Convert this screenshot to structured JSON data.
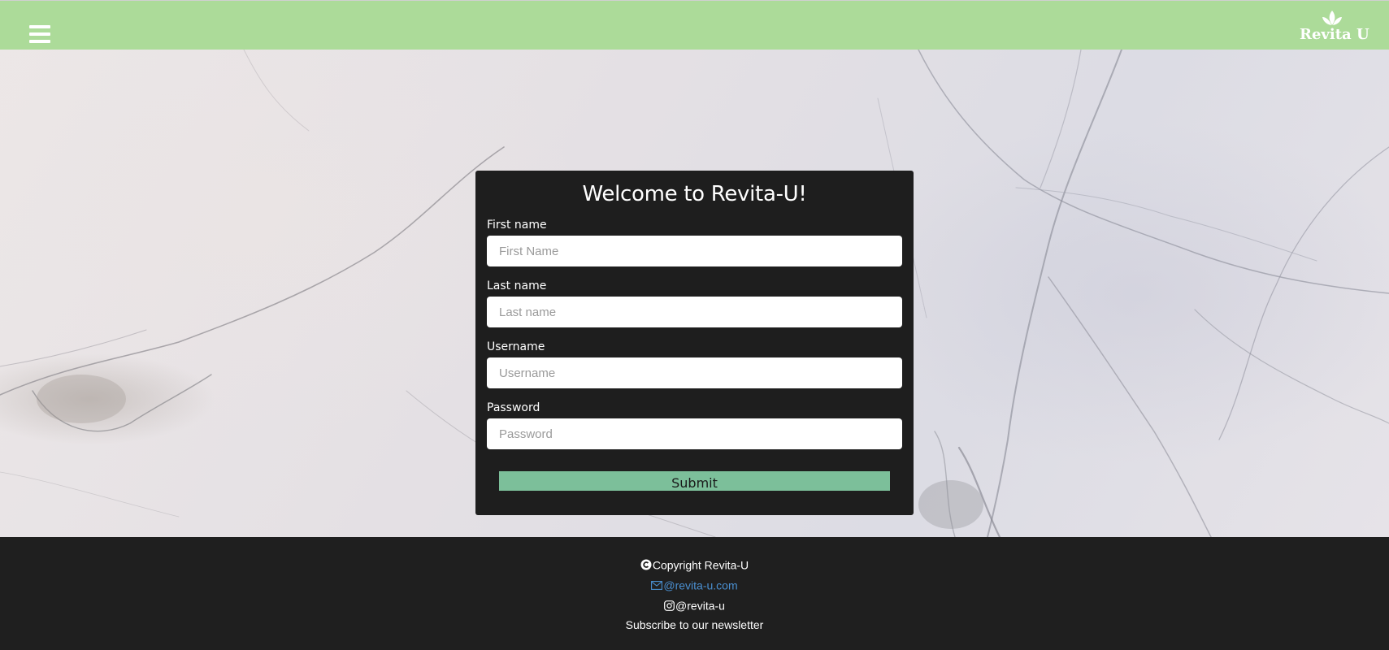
{
  "header": {
    "menu_icon": "hamburger-menu-icon",
    "logo_icon": "leaf-icon",
    "logo_text": "Revita U",
    "background_color": "#acdb99"
  },
  "form": {
    "title": "Welcome to Revita-U!",
    "fields": [
      {
        "label": "First name",
        "placeholder": "First Name",
        "value": ""
      },
      {
        "label": "Last name",
        "placeholder": "Last name",
        "value": ""
      },
      {
        "label": "Username",
        "placeholder": "Username",
        "value": ""
      },
      {
        "label": "Password",
        "placeholder": "Password",
        "value": ""
      }
    ],
    "submit_label": "Submit",
    "submit_color": "#7cbf9a",
    "card_color": "#1e1e1e"
  },
  "footer": {
    "copyright_icon": "copyright-icon",
    "copyright_text": "Copyright Revita-U",
    "email_icon": "envelope-icon",
    "email_text": "@revita-u.com",
    "instagram_icon": "instagram-icon",
    "instagram_text": "@revita-u",
    "newsletter_text": "Subscribe to our newsletter",
    "link_color": "#4a8fd0"
  }
}
